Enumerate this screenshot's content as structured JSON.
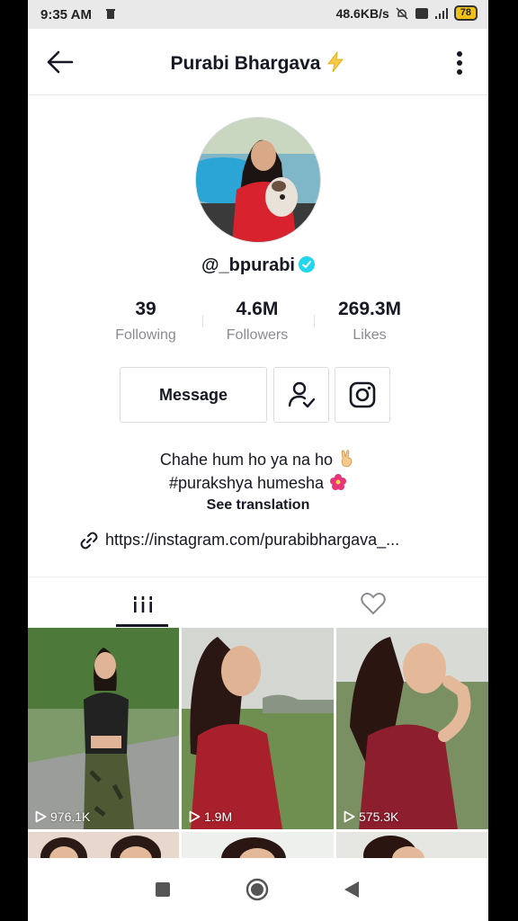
{
  "status_bar": {
    "time": "9:35 AM",
    "network_speed": "48.6KB/s",
    "battery": "78"
  },
  "header": {
    "title": "Purabi Bhargava",
    "title_emoji": "lightning-bolt"
  },
  "profile": {
    "username": "@_bpurabi",
    "verified": true
  },
  "stats": [
    {
      "value": "39",
      "label": "Following"
    },
    {
      "value": "4.6M",
      "label": "Followers"
    },
    {
      "value": "269.3M",
      "label": "Likes"
    }
  ],
  "buttons": {
    "message": "Message"
  },
  "bio": {
    "line1": "Chahe hum ho ya na ho",
    "line2": "#purakshya humesha",
    "see_translation": "See translation",
    "link": "https://instagram.com/purabibhargava_..."
  },
  "videos": [
    {
      "views": "976.1K"
    },
    {
      "views": "1.9M"
    },
    {
      "views": "575.3K"
    }
  ],
  "colors": {
    "text": "#161823",
    "muted": "#8a8b91",
    "verified": "#20d5ec",
    "bolt": "#f7c948"
  }
}
